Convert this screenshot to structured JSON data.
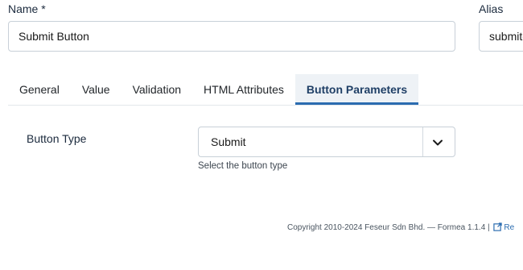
{
  "form": {
    "name_label": "Name *",
    "name_value": "Submit Button",
    "alias_label": "Alias",
    "alias_value": "submit-button"
  },
  "tabs": [
    {
      "label": "General",
      "active": false
    },
    {
      "label": "Value",
      "active": false
    },
    {
      "label": "Validation",
      "active": false
    },
    {
      "label": "HTML Attributes",
      "active": false
    },
    {
      "label": "Button Parameters",
      "active": true
    }
  ],
  "button_params": {
    "type_label": "Button Type",
    "type_value": "Submit",
    "type_help": "Select the button type"
  },
  "footer": {
    "copyright": "Copyright 2010-2024 Feseur Sdn Bhd. — Formea 1.1.4 |",
    "link_text": "Re"
  },
  "colors": {
    "accent": "#2b6cb0",
    "active_tab_bg": "#eef2f6",
    "label": "#1b2a3d"
  }
}
